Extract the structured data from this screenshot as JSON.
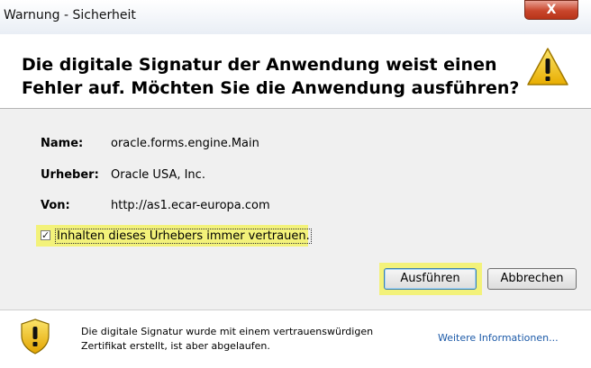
{
  "window": {
    "title": "Warnung - Sicherheit",
    "close_label": "X"
  },
  "header": {
    "headline_line1": "Die digitale Signatur der Anwendung weist einen",
    "headline_line2": "Fehler auf.  Möchten Sie die Anwendung ausführen?"
  },
  "details": {
    "name_label": "Name:",
    "name_value": "oracle.forms.engine.Main",
    "publisher_label": "Urheber:",
    "publisher_value": "Oracle USA, Inc.",
    "from_label": "Von:",
    "from_value": "http://as1.ecar-europa.com"
  },
  "checkbox": {
    "label": "Inhalten dieses Urhebers immer vertrauen.",
    "checked": true
  },
  "buttons": {
    "run": "Ausführen",
    "cancel": "Abbrechen"
  },
  "footer": {
    "message_line1": "Die digitale Signatur wurde mit einem vertrauenswürdigen",
    "message_line2": "Zertifikat erstellt, ist aber abgelaufen.",
    "more_info": "Weitere Informationen..."
  },
  "colors": {
    "highlight": "#f3f27a",
    "link": "#1c5aa8",
    "warning": "#f2c511"
  },
  "icons": {
    "header_icon": "warning-icon",
    "footer_icon": "shield-warning-icon"
  }
}
